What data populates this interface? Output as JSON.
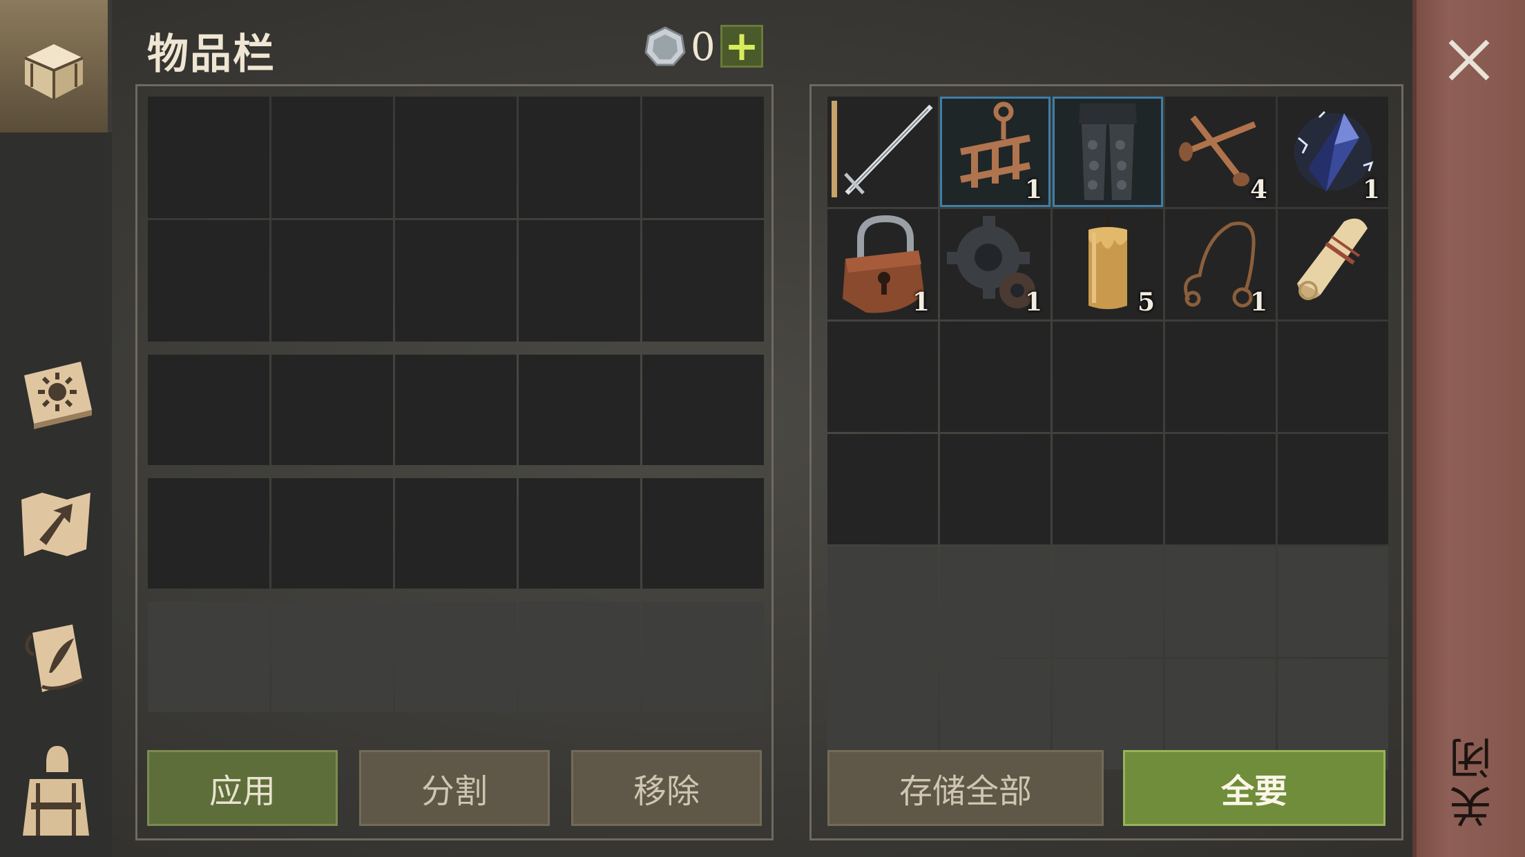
{
  "header": {
    "title": "物品栏",
    "currency_icon": "silver-coin-icon",
    "currency_amount": "0",
    "add_currency_icon": "plus-icon"
  },
  "sidebar": {
    "tabs": [
      {
        "icon": "treasure-chest-icon",
        "active": true
      },
      {
        "icon": "sun-book-icon",
        "active": false
      },
      {
        "icon": "map-arrow-icon",
        "active": false
      },
      {
        "icon": "quill-scroll-icon",
        "active": false
      },
      {
        "icon": "backpack-character-icon",
        "active": false
      }
    ]
  },
  "left_panel": {
    "rows": 5,
    "cols": 5,
    "dim_rows": [
      4
    ],
    "buttons": {
      "apply": "应用",
      "split": "分割",
      "remove": "移除"
    }
  },
  "right_panel": {
    "rows": 6,
    "cols": 5,
    "dim_rows": [
      4,
      5
    ],
    "items": [
      {
        "name": "sword",
        "icon": "sword-icon",
        "qty": ""
      },
      {
        "name": "wooden-contraption",
        "icon": "wooden-frame-icon",
        "qty": "1",
        "selected": true
      },
      {
        "name": "leg-armor",
        "icon": "leg-armor-icon",
        "qty": "",
        "selected": true
      },
      {
        "name": "nails",
        "icon": "nails-icon",
        "qty": "4"
      },
      {
        "name": "crystal",
        "icon": "crystal-icon",
        "qty": "1"
      },
      {
        "name": "padlock",
        "icon": "padlock-icon",
        "qty": "1"
      },
      {
        "name": "gear",
        "icon": "gear-icon",
        "qty": "1"
      },
      {
        "name": "candle",
        "icon": "candle-icon",
        "qty": "5"
      },
      {
        "name": "rope",
        "icon": "rope-icon",
        "qty": "1"
      },
      {
        "name": "paper-scroll",
        "icon": "paper-scroll-icon",
        "qty": ""
      }
    ],
    "buttons": {
      "store_all": "存储全部",
      "take_all": "全要"
    }
  },
  "close": {
    "label": "关闭",
    "icon": "close-icon"
  },
  "colors": {
    "accent_green": "#6f8d3b",
    "close_strip": "#8e5f56",
    "selection": "#3d7fa8"
  }
}
